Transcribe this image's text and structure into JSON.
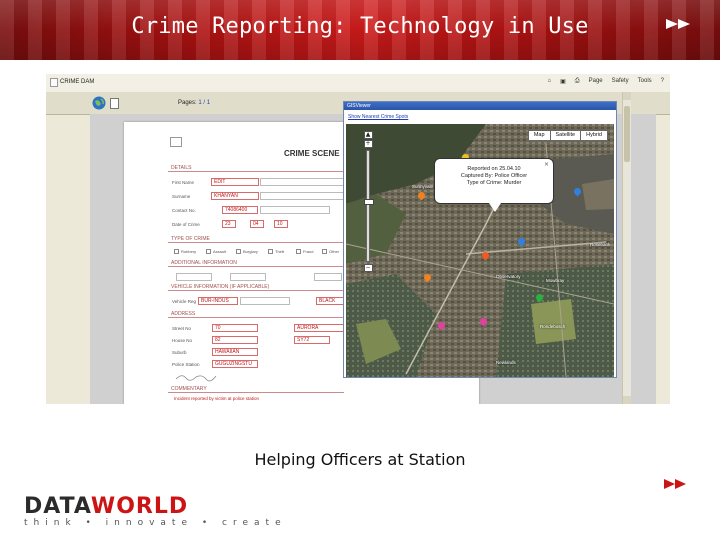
{
  "slide": {
    "title": "Crime Reporting: Technology in Use",
    "caption": "Helping Officers at Station"
  },
  "brand": {
    "logo_part1": "DATA",
    "logo_part2": "WORLD",
    "tagline": "think • innovate • create",
    "accent": "#cc1414"
  },
  "browser": {
    "tab_title": "CRIME DAM",
    "tools": [
      "Page",
      "Safety",
      "Tools",
      "?"
    ]
  },
  "app": {
    "pages_label": "Pages:",
    "pages_value": "1 / 1"
  },
  "form": {
    "title": "CRIME SCENE",
    "sections": {
      "details": "DETAILS",
      "type_of_crime": "TYPE OF CRIME",
      "additional": "ADDITIONAL INFORMATION",
      "vehicle": "VEHICLE INFORMATION (IF APPLICABLE)",
      "address": "ADDRESS",
      "commentary": "COMMENTARY"
    },
    "fields": {
      "first_name": {
        "label": "First Name",
        "value": "EDIT"
      },
      "surname": {
        "label": "Surname",
        "value": "KHANYAN"
      },
      "id_no": {
        "label": "Contact No.",
        "value": "74086400"
      },
      "date_of_crime": {
        "label": "Date of Crime",
        "values": [
          "23",
          "04",
          "10"
        ]
      },
      "vehicle_reg": {
        "label": "Vehicle Reg",
        "value": "BUR-INDUS"
      },
      "vehicle_colour": {
        "value": "BLACK"
      },
      "street_no": {
        "label": "Street No",
        "value": "70"
      },
      "street_name": {
        "value": "AURORA"
      },
      "house_no": {
        "label": "House No",
        "value": "82"
      },
      "suburb_value": {
        "value": "SY72"
      },
      "suburb": {
        "label": "Suburb",
        "value": "HAWAIIAN"
      },
      "station": {
        "label": "Police Station",
        "value": "GUGUZINGSTU"
      },
      "commentary_text": "Incident reported by victim at police station"
    },
    "crime_types": [
      "Robbery",
      "Assault",
      "Burglary",
      "Theft",
      "Fraud",
      "Other"
    ]
  },
  "gis": {
    "window_title": "GISViewer",
    "link": "Show Nearest Crime Spots",
    "map_types": [
      "Map",
      "Satellite",
      "Hybrid"
    ],
    "info_lines": [
      "Reported on 25.04.10",
      "Captured By: Police Officer",
      "Type of Crime: Murder"
    ],
    "map_labels": [
      "Sunnyvale",
      "Observatory",
      "Mowbray",
      "Rosebank",
      "Rondebosch",
      "Newlands"
    ]
  }
}
